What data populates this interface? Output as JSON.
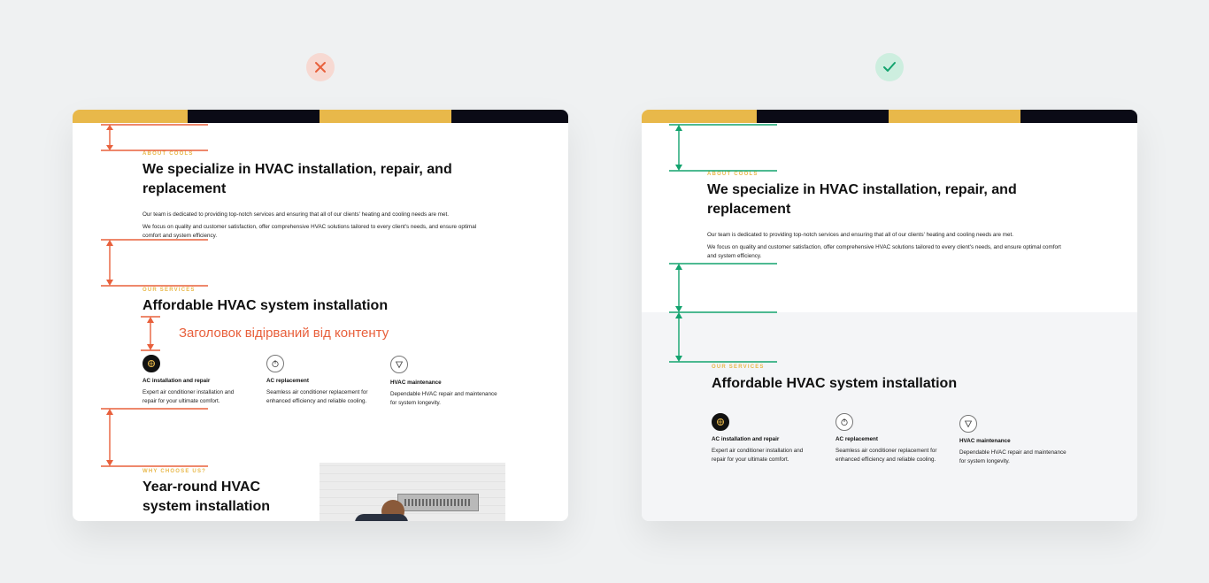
{
  "colors": {
    "background": "#eff1f2",
    "bad": "#e8603c",
    "good": "#13a36e",
    "yellow": "#e8b84a",
    "dark": "#0b0b16"
  },
  "status_icons": {
    "bad": "close-icon",
    "good": "check-icon"
  },
  "bad_example": {
    "about": {
      "eyebrow": "ABOUT COOLS",
      "title_line1": "We specialize in HVAC installation, repair, and",
      "title_line2": "replacement",
      "p1": "Our team is dedicated to providing top-notch services and ensuring that all of our clients' heating and cooling needs are met.",
      "p2_line1": "We focus on quality and customer satisfaction, offer comprehensive HVAC solutions tailored to every client's needs, and ensure optimal",
      "p2_line2": "comfort and system efficiency."
    },
    "services": {
      "eyebrow": "OUR SERVICES",
      "title": "Affordable HVAC system installation",
      "items": [
        {
          "icon": "fan-icon",
          "title": "AC installation and repair",
          "desc_line1": "Expert air conditioner installation and",
          "desc_line2": "repair for your ultimate comfort."
        },
        {
          "icon": "thermostat-icon",
          "title": "AC replacement",
          "desc_line1": "Seamless air conditioner replacement for",
          "desc_line2": "enhanced efficiency and reliable cooling."
        },
        {
          "icon": "funnel-icon",
          "title": "HVAC maintenance",
          "desc_line1": "Dependable HVAC repair and maintenance",
          "desc_line2": "for system longevity."
        }
      ]
    },
    "annotation": "Заголовок відірваний від контенту",
    "why": {
      "eyebrow": "WHY CHOOSE US?",
      "title_line1": "Year-round HVAC",
      "title_line2": "system installation"
    }
  },
  "good_example": {
    "about": {
      "eyebrow": "ABOUT COOLS",
      "title_line1": "We specialize in HVAC installation, repair, and",
      "title_line2": "replacement",
      "p1": "Our team is dedicated to providing top-notch services and ensuring that all of our clients' heating and cooling needs are met.",
      "p2_line1": "We focus on quality and customer satisfaction, offer comprehensive HVAC solutions tailored to every client's needs, and ensure optimal comfort",
      "p2_line2": "and system efficiency."
    },
    "services": {
      "eyebrow": "OUR SERVICES",
      "title": "Affordable HVAC system installation",
      "items": [
        {
          "icon": "fan-icon",
          "title": "AC installation and repair",
          "desc_line1": "Expert air conditioner installation and",
          "desc_line2": "repair for your ultimate comfort."
        },
        {
          "icon": "thermostat-icon",
          "title": "AC replacement",
          "desc_line1": "Seamless air conditioner replacement for",
          "desc_line2": "enhanced efficiency and reliable cooling."
        },
        {
          "icon": "funnel-icon",
          "title": "HVAC maintenance",
          "desc_line1": "Dependable HVAC repair and maintenance",
          "desc_line2": "for system longevity."
        }
      ]
    }
  }
}
